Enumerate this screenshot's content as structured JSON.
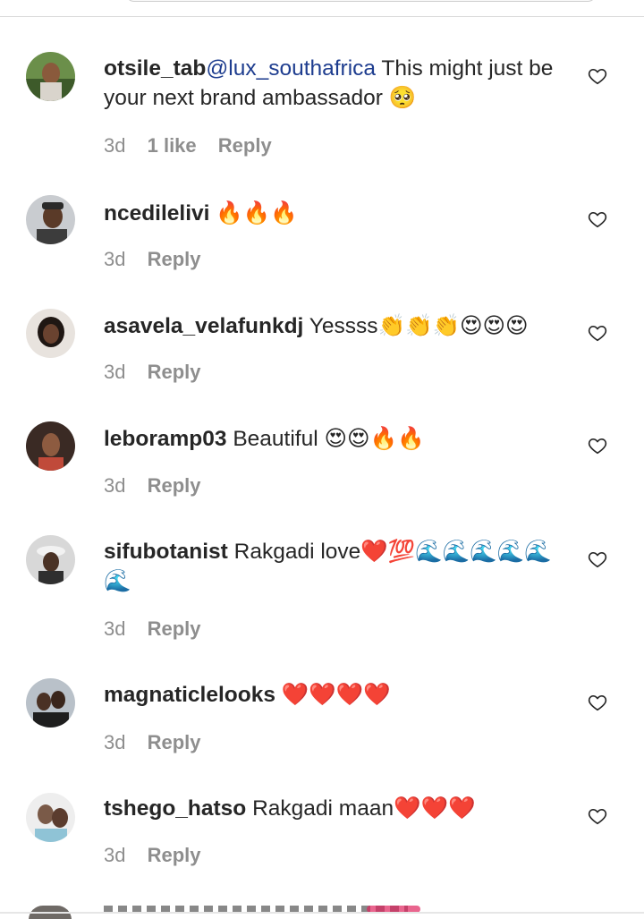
{
  "comments": [
    {
      "username": "otsile_tab",
      "mention": "@lux_southafrica",
      "text": " This might just be your next brand ambassador 🥺",
      "time": "3d",
      "likes": "1 like",
      "reply": "Reply"
    },
    {
      "username": "ncedilelivi",
      "text": " 🔥🔥🔥",
      "time": "3d",
      "reply": "Reply"
    },
    {
      "username": "asavela_velafunkdj",
      "text": " Yessss👏👏👏😍😍😍",
      "time": "3d",
      "reply": "Reply"
    },
    {
      "username": "leboramp03",
      "text": " Beautiful 😍😍🔥🔥",
      "time": "3d",
      "reply": "Reply"
    },
    {
      "username": "sifubotanist",
      "text": " Rakgadi love❤️💯🌊🌊🌊🌊🌊🌊",
      "time": "3d",
      "reply": "Reply"
    },
    {
      "username": "magnaticlelooks",
      "text": " ❤️❤️❤️❤️",
      "time": "3d",
      "reply": "Reply"
    },
    {
      "username": "tshego_hatso",
      "text": " Rakgadi maan❤️❤️❤️",
      "time": "3d",
      "reply": "Reply"
    }
  ],
  "icons": {
    "like": "heart-outline-icon"
  },
  "colors": {
    "text": "#262626",
    "meta": "#8e8e8e",
    "mention": "#1e3d8f"
  }
}
